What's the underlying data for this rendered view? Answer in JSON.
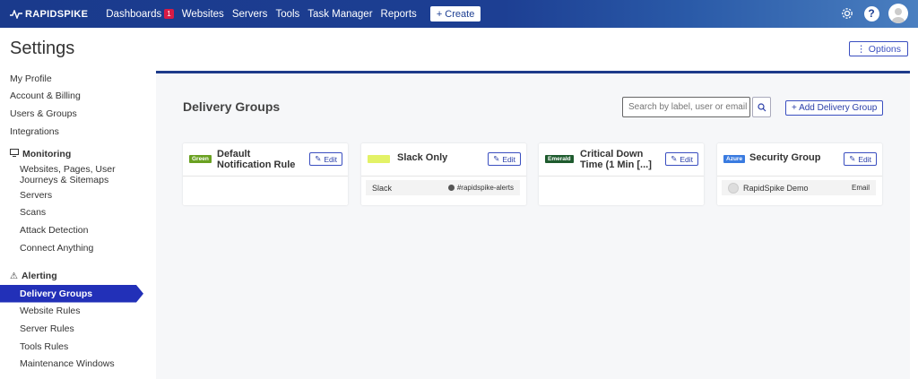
{
  "nav": {
    "brand": "RAPIDSPIKE",
    "items": [
      {
        "label": "Dashboards",
        "badge": "1"
      },
      {
        "label": "Websites"
      },
      {
        "label": "Servers"
      },
      {
        "label": "Tools"
      },
      {
        "label": "Task Manager"
      },
      {
        "label": "Reports"
      }
    ],
    "create_label": "+ Create",
    "help_label": "?"
  },
  "page": {
    "title": "Settings",
    "options_label": "⋮ Options"
  },
  "sidebar": {
    "items": [
      "My Profile",
      "Account & Billing",
      "Users & Groups",
      "Integrations"
    ],
    "monitoring": {
      "label": "Monitoring",
      "items": [
        "Websites, Pages, User",
        "Journeys & Sitemaps",
        "Servers",
        "Scans",
        "Attack Detection",
        "Connect Anything"
      ]
    },
    "alerting": {
      "label": "Alerting",
      "items": [
        "Delivery Groups",
        "Website Rules",
        "Server Rules",
        "Tools Rules",
        "Maintenance Windows"
      ]
    }
  },
  "main": {
    "title": "Delivery Groups",
    "search_placeholder": "Search by label, user or email",
    "add_label": "+ Add Delivery Group",
    "cards": [
      {
        "tag": "Green",
        "tag_color": "#6aa121",
        "title_line1": "Default",
        "title_line2": "Notification Rule",
        "edit": "Edit"
      },
      {
        "tag": "",
        "tag_color": "#e3f266",
        "title_line1": "Slack Only",
        "title_line2": "",
        "edit": "Edit",
        "row_left": "Slack",
        "row_right": "#rapidspike-alerts"
      },
      {
        "tag": "Emerald",
        "tag_color": "#1e5b2e",
        "title_line1": "Critical Down",
        "title_line2": "Time (1 Min [...]",
        "edit": "Edit"
      },
      {
        "tag": "Azure",
        "tag_color": "#3a7be0",
        "title_line1": "Security Group",
        "title_line2": "",
        "edit": "Edit",
        "row_left": "RapidSpike Demo",
        "row_right": "Email"
      }
    ]
  }
}
